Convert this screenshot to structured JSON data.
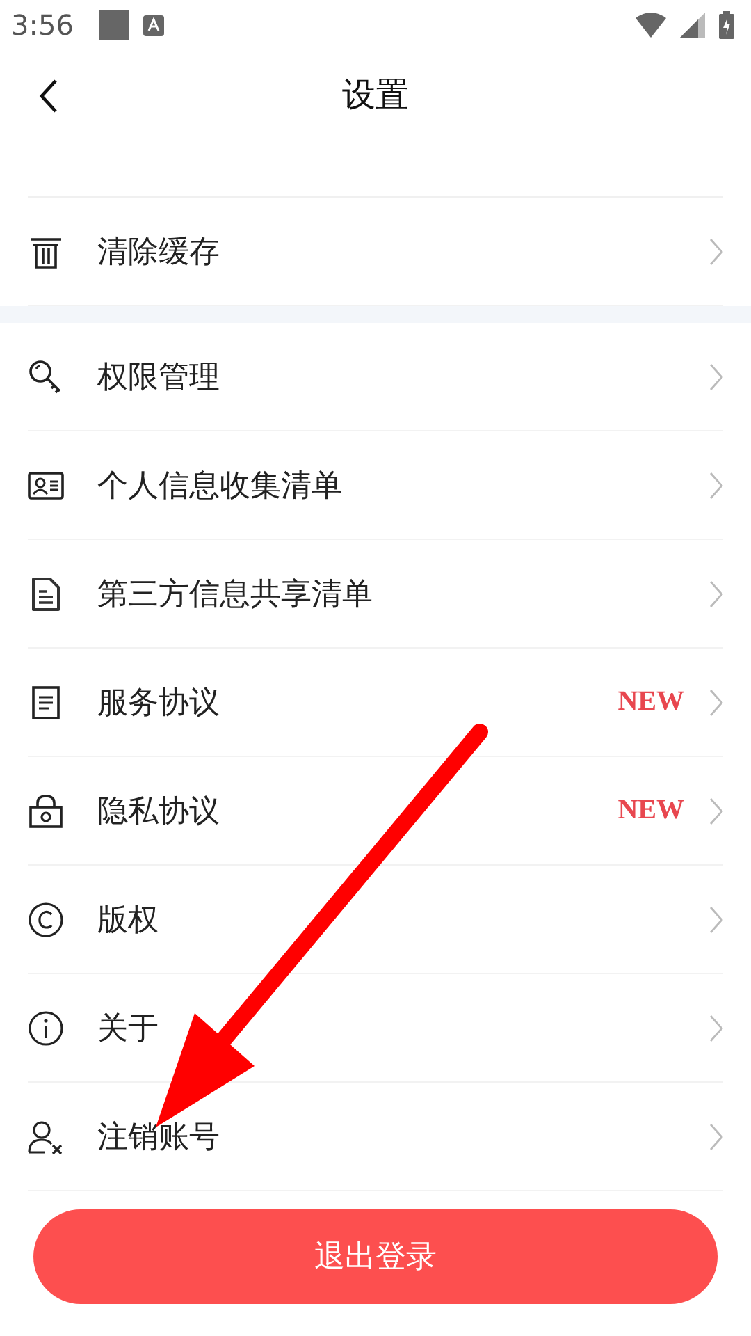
{
  "status_bar": {
    "time": "3:56"
  },
  "header": {
    "title": "设置"
  },
  "sections": [
    [
      {
        "kind": "trash",
        "label": "清除缓存"
      }
    ],
    [
      {
        "kind": "key",
        "label": "权限管理"
      },
      {
        "kind": "card",
        "label": "个人信息收集清单"
      },
      {
        "kind": "document",
        "label": "第三方信息共享清单"
      },
      {
        "kind": "list",
        "label": "服务协议",
        "badge": "NEW"
      },
      {
        "kind": "lock",
        "label": "隐私协议",
        "badge": "NEW"
      },
      {
        "kind": "copyright",
        "label": "版权"
      },
      {
        "kind": "info",
        "label": "关于"
      },
      {
        "kind": "account",
        "label": "注销账号"
      }
    ]
  ],
  "logout_button": {
    "label": "退出登录"
  }
}
